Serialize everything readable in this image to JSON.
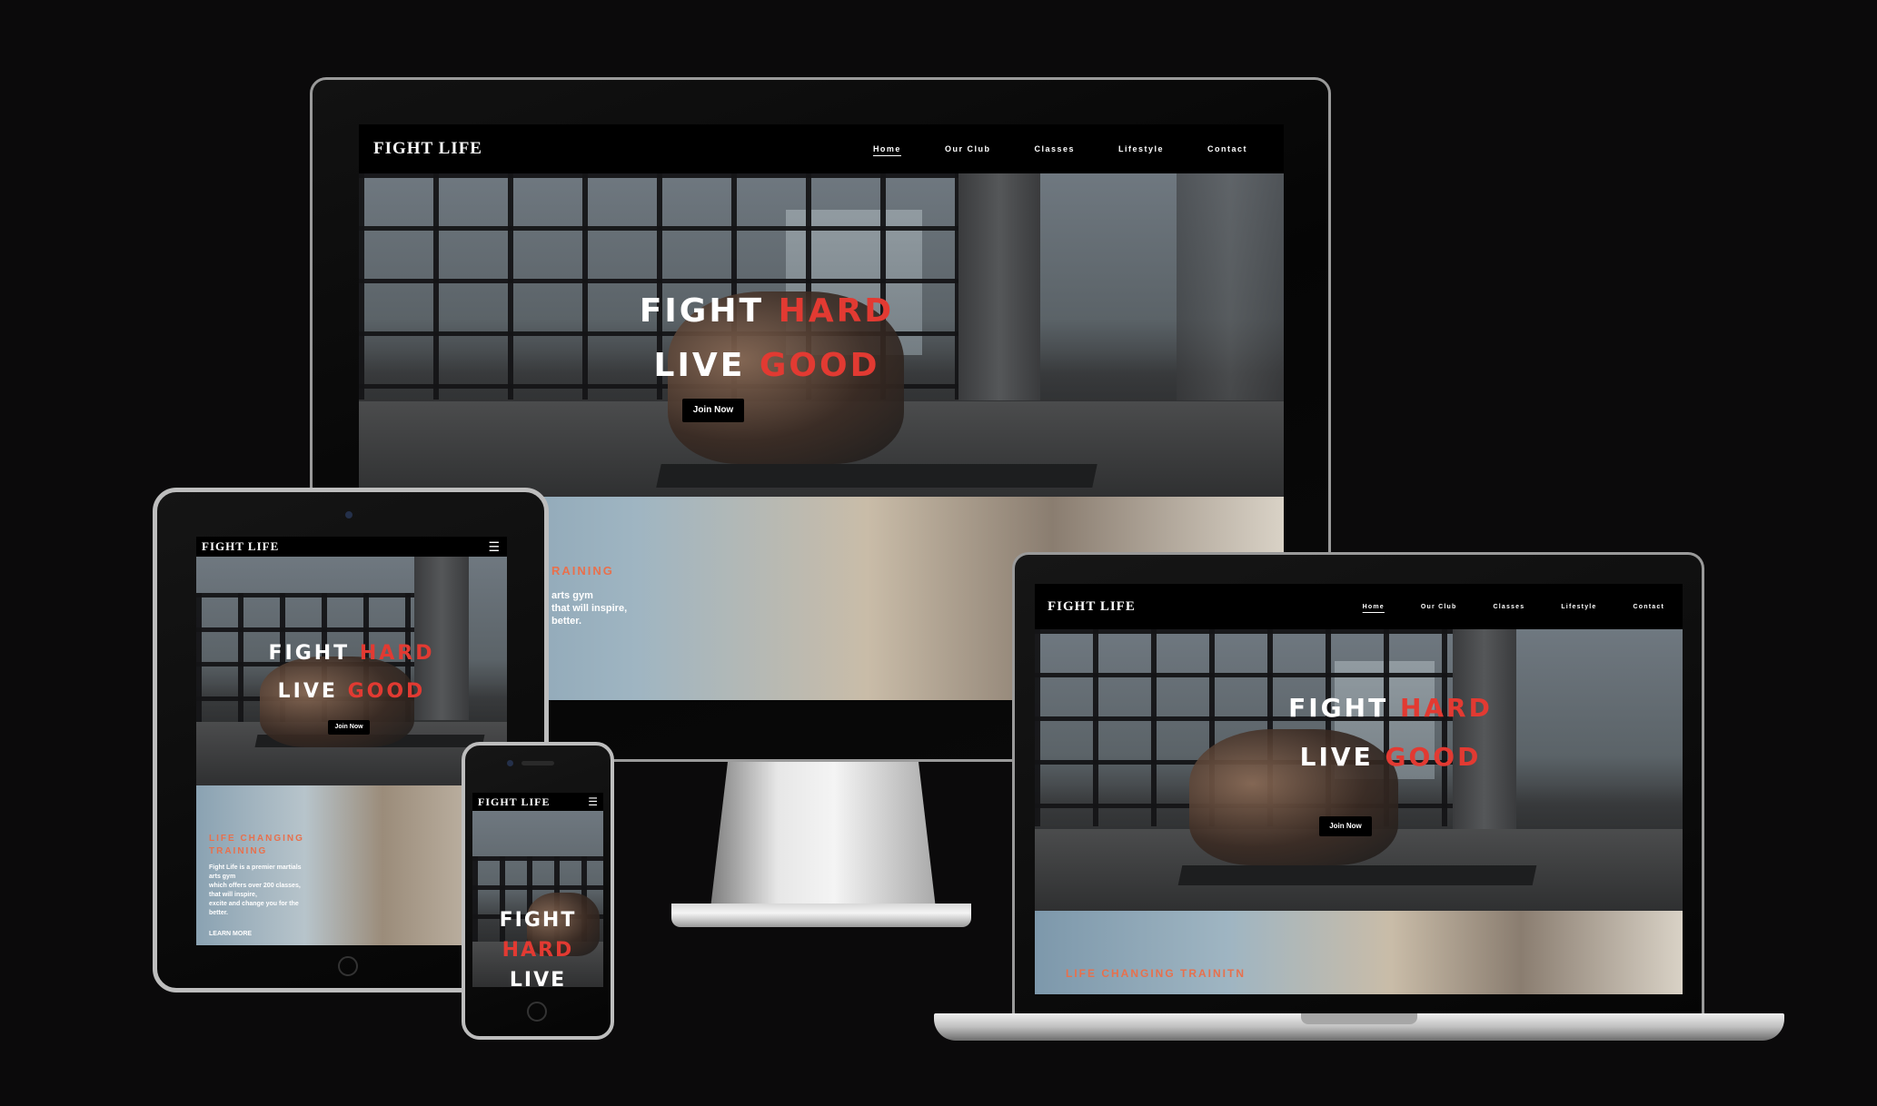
{
  "site": {
    "logo": "FIGHT LIFE",
    "nav": [
      "Home",
      "Our Club",
      "Classes",
      "Lifestyle",
      "Contact"
    ],
    "hero": {
      "line1_white": "FIGHT",
      "line1_red": "HARD",
      "line2_white": "LIVE",
      "line2_red": "GOOD",
      "cta": "Join Now"
    },
    "training": {
      "tag": "LIFE CHANGING TRAINING",
      "tag_partial": "RAINING",
      "tag_laptop": "LIFE CHANGING TRAINITN",
      "body_lines": [
        "Fight Life is a premier martials",
        "arts gym",
        "which offers over 200 classes,",
        "that will inspire,",
        "excite and change you for the",
        "better."
      ],
      "body_partial": [
        "arts gym",
        "that will inspire,",
        "better."
      ],
      "cta": "LEARN MORE"
    },
    "mobile_headline": [
      "FIGHT",
      "HARD",
      "LIVE"
    ]
  },
  "icons": {
    "menu": "hamburger-icon",
    "home_button": "home-button-icon"
  },
  "colors": {
    "background": "#0b0a0b",
    "accent_red": "#e23a32",
    "accent_orange": "#e8704c",
    "nav_bg": "#000000"
  }
}
